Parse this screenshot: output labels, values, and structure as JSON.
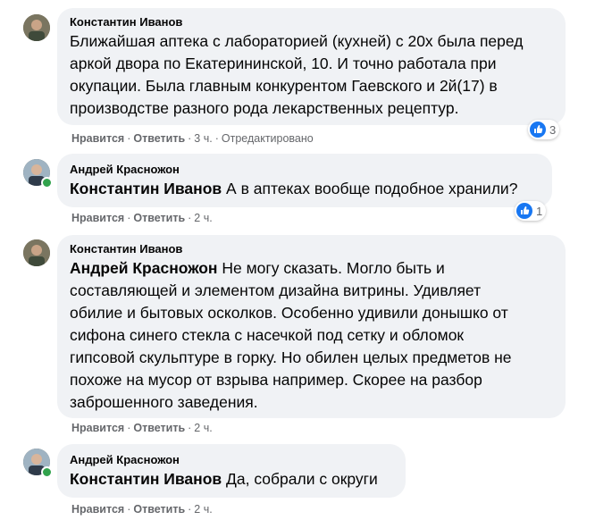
{
  "colors": {
    "bubble_bg": "#f0f2f5",
    "meta": "#65676b",
    "like_blue": "#1877f2",
    "online": "#31a24c"
  },
  "actions": {
    "like": "Нравится",
    "reply": "Ответить",
    "separator": "·"
  },
  "comments": [
    {
      "author": "Константин Иванов",
      "lines": [
        "Ближайшая аптека с лабораторией (кухней) с 20х была перед",
        "аркой двора по Екатерининской, 10. И точно работала при",
        "окупации. Была главным конкурентом Гаевского и 2й(17) в",
        "производстве разного рода лекарственных рецептур."
      ],
      "time": "3 ч.",
      "edited": "Отредактировано",
      "reactions": {
        "icon": "like-icon",
        "count": "3"
      }
    },
    {
      "author": "Андрей Красножон",
      "mention": "Константин Иванов",
      "text": "А в аптеках вообще подобное хранили?",
      "time": "2 ч.",
      "reactions": {
        "icon": "like-icon",
        "count": "1"
      }
    },
    {
      "author": "Константин Иванов",
      "mention": "Андрей Красножон",
      "first_line_rest": "Не могу сказать. Могло быть и",
      "lines": [
        "составляющей и элементом дизайна витрины. Удивляет",
        "обилие и бытовых осколков. Особенно удивили донышко от",
        "сифона синего стекла с насечкой под сетку и обломок",
        "гипсовой скульптуре в горку. Но обилен целых предметов не",
        "похоже на мусор от взрыва например. Скорее на разбор",
        "заброшенного заведения."
      ],
      "time": "2 ч."
    },
    {
      "author": "Андрей Красножон",
      "mention": "Константин Иванов",
      "text": "Да, собрали с округи",
      "time": "2 ч."
    }
  ]
}
